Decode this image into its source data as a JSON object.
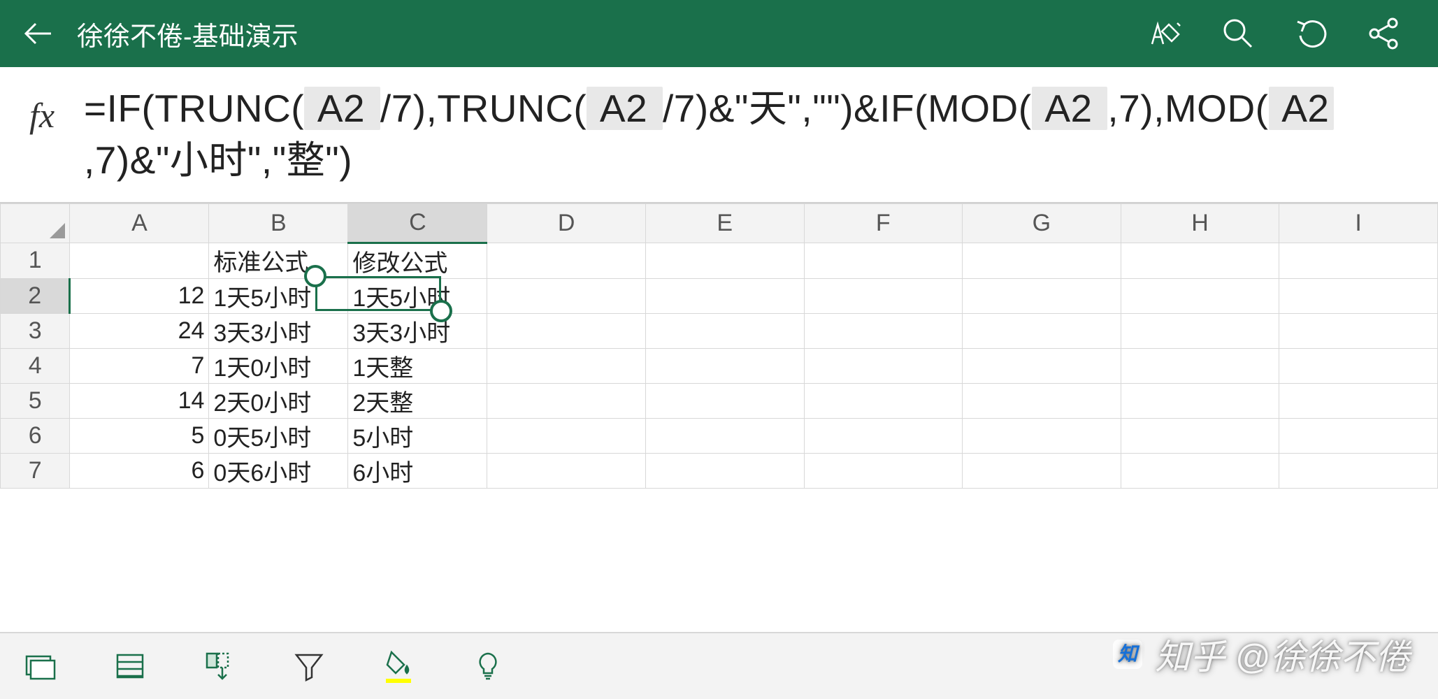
{
  "titlebar": {
    "title": "徐徐不倦-基础演示"
  },
  "formula": {
    "fx_label": "fx",
    "p1": "=IF(TRUNC(",
    "r1": " A2 ",
    "p2": "/7),TRUNC(",
    "r2": " A2 ",
    "p3": "/7)&\"天\",\"\")&IF(MOD(",
    "r3": " A2 ",
    "p4": ",7),MOD(",
    "r4": " A2 ",
    "p5": ",7)&\"小时\",\"整\")"
  },
  "columns": [
    "A",
    "B",
    "C",
    "D",
    "E",
    "F",
    "G",
    "H",
    "I"
  ],
  "row_numbers": [
    "1",
    "2",
    "3",
    "4",
    "5",
    "6",
    "7"
  ],
  "cells": {
    "B1": "标准公式",
    "C1": "修改公式",
    "A2": "12",
    "B2": "1天5小时",
    "C2": "1天5小时",
    "A3": "24",
    "B3": "3天3小时",
    "C3": "3天3小时",
    "A4": "7",
    "B4": "1天0小时",
    "C4": "1天整",
    "A5": "14",
    "B5": "2天0小时",
    "C5": "2天整",
    "A6": "5",
    "B6": "0天5小时",
    "C6": "5小时",
    "A7": "6",
    "B7": "0天6小时",
    "C7": "6小时"
  },
  "active_cell": "C2",
  "watermark": "知乎 @徐徐不倦"
}
